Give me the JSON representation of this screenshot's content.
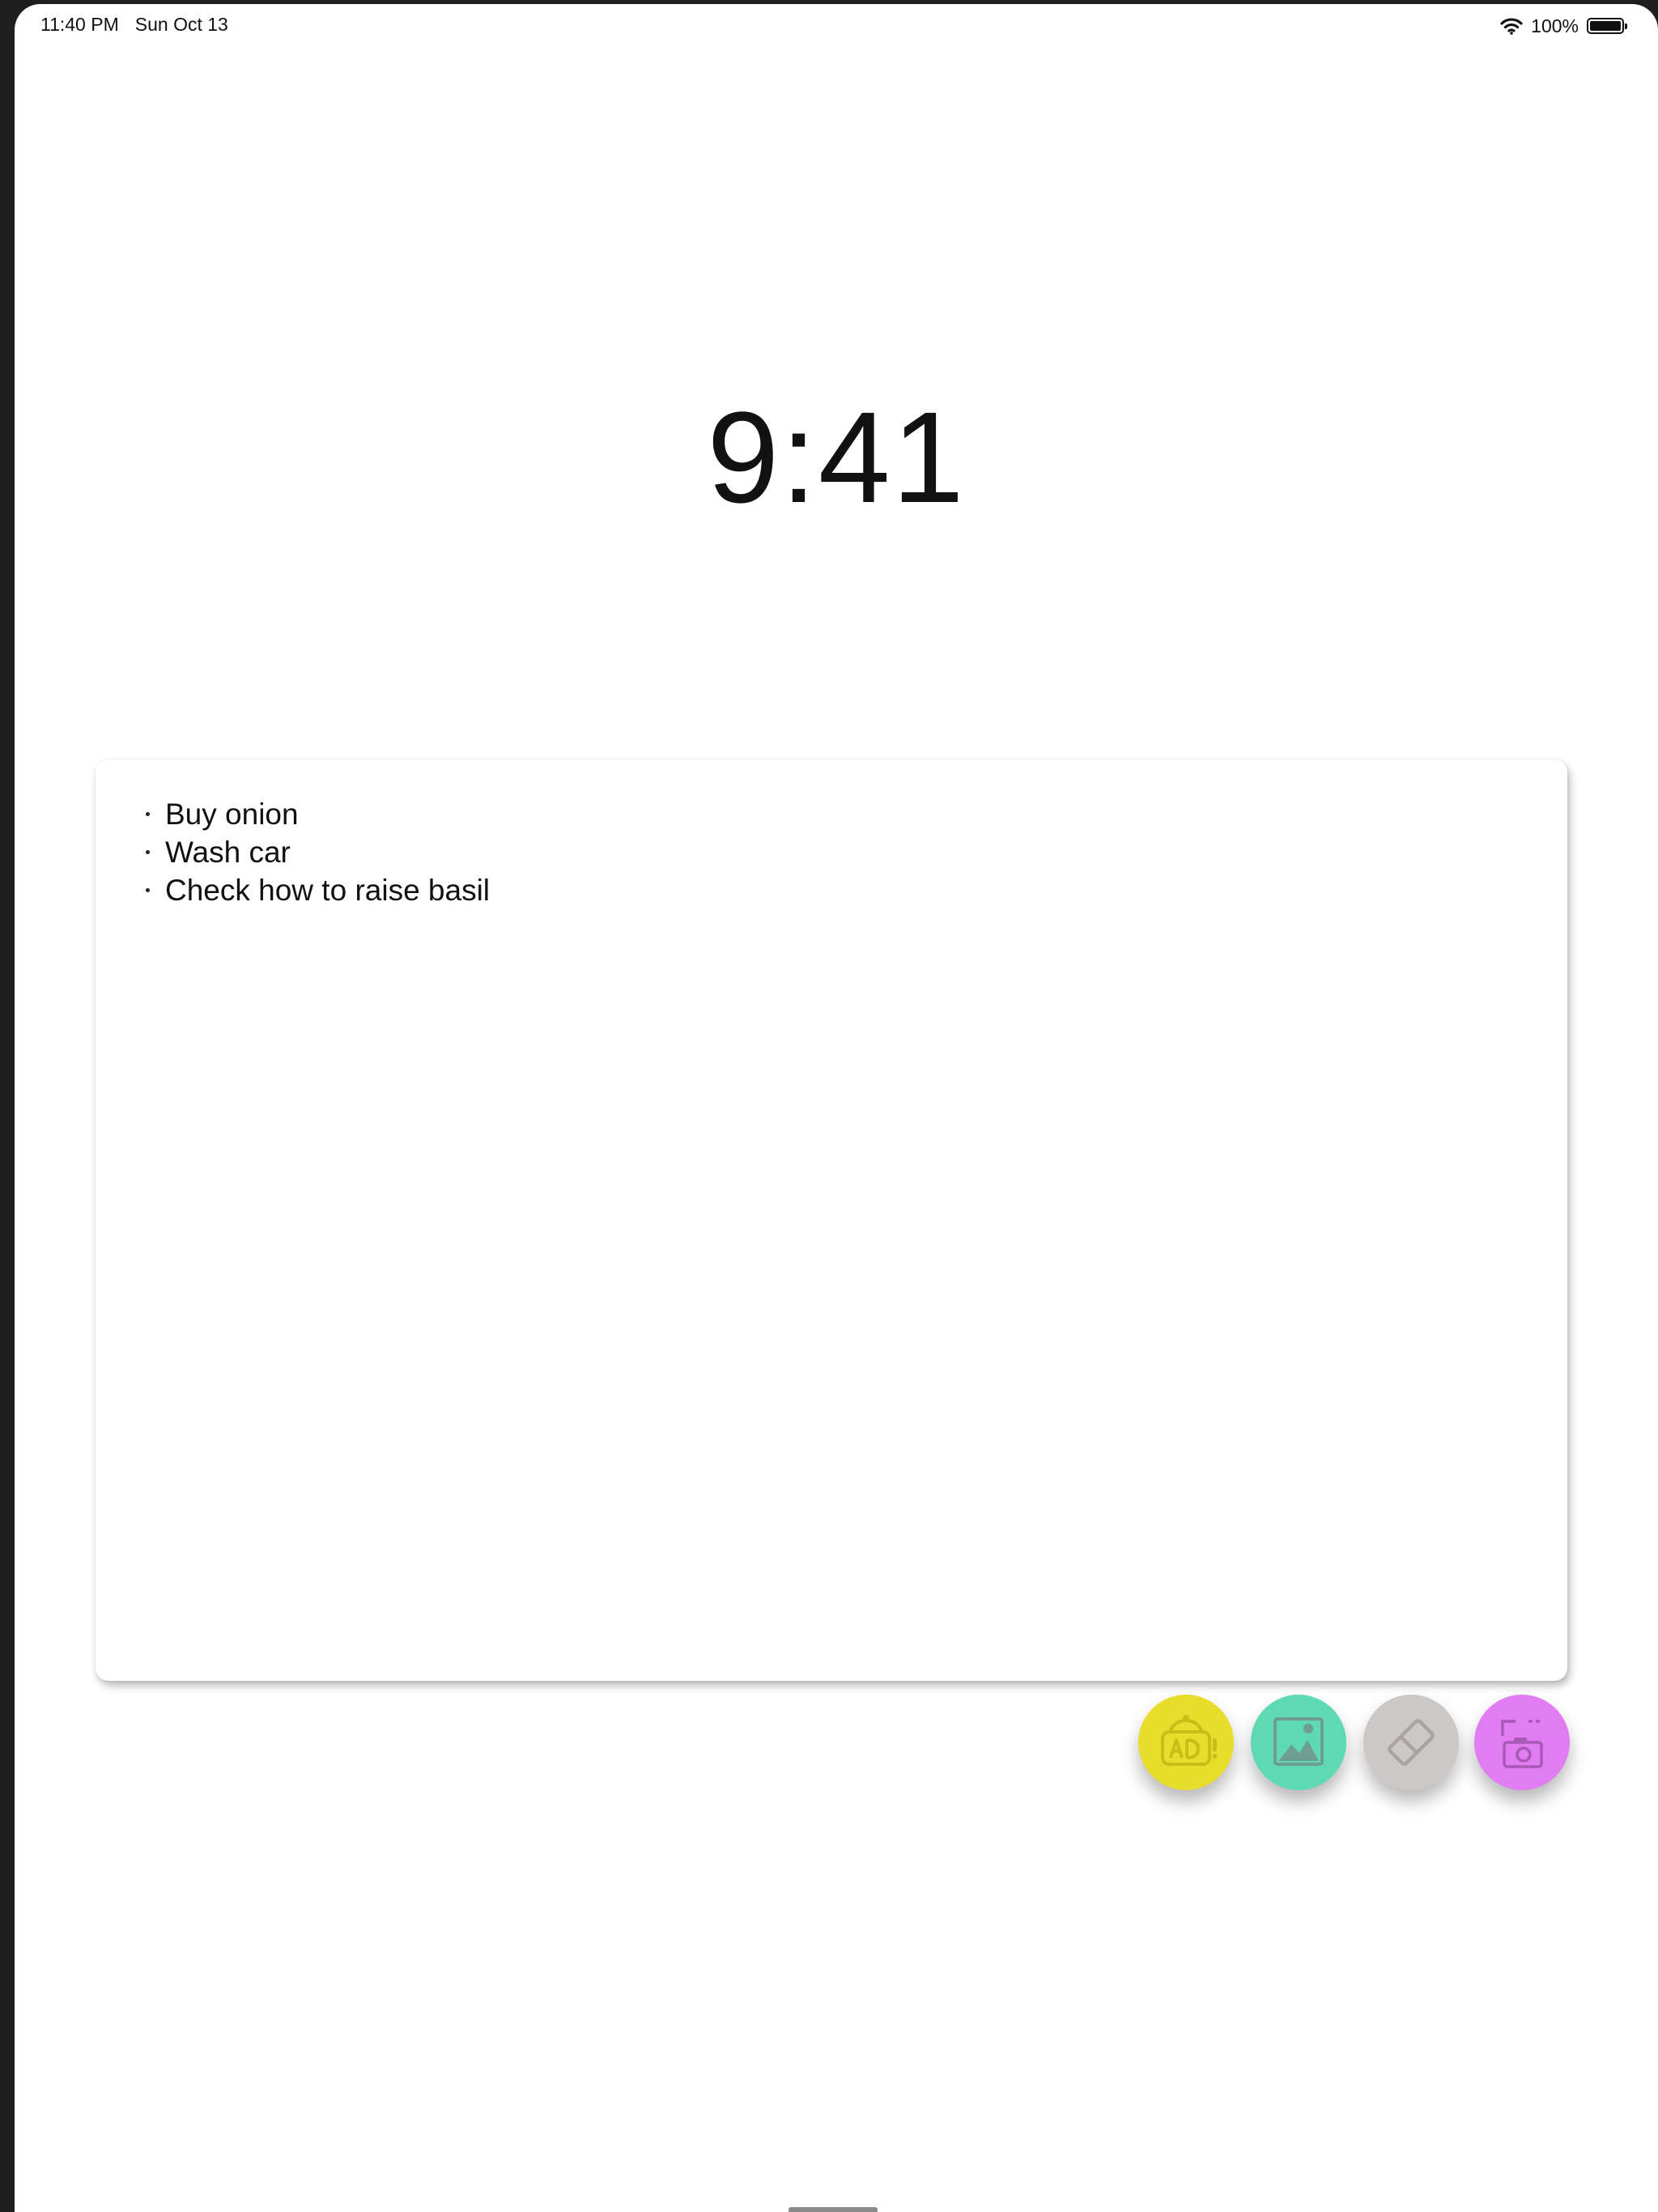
{
  "status_bar": {
    "time": "11:40 PM",
    "date": "Sun Oct 13",
    "battery_percent": "100%",
    "battery_level": 1.0,
    "wifi_icon": "wifi-icon",
    "battery_icon": "battery-icon"
  },
  "clock": {
    "time": "9:41"
  },
  "note": {
    "items": [
      "Buy onion",
      "Wash car",
      "Check how to raise basil"
    ]
  },
  "actions": [
    {
      "name": "ad-button",
      "icon": "ad-icon",
      "color": "#e8dc2c"
    },
    {
      "name": "image-button",
      "icon": "image-icon",
      "color": "#5fd9b4"
    },
    {
      "name": "eraser-button",
      "icon": "eraser-icon",
      "color": "#cdc8c8"
    },
    {
      "name": "camera-button",
      "icon": "camera-icon",
      "color": "#e27cf2"
    }
  ]
}
